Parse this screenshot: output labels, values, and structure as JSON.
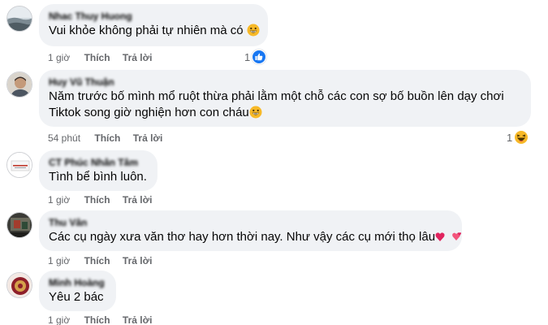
{
  "comments": [
    {
      "author": "Nhac Thuy Huong",
      "text_lines": [
        "Vui khỏe không phải tự nhiên mà có"
      ],
      "emoji": "grinning-face",
      "time": "1 giờ",
      "like_label": "Thích",
      "reply_label": "Trả lời",
      "reaction": {
        "count": "1",
        "type": "like"
      }
    },
    {
      "author": "Huy Vũ Thuận",
      "text_lines": [
        "Năm trước bố mình mổ ruột thừa phải lằm một chỗ các con sợ bố buồn lên dạy chơi",
        "Tiktok song giờ nghiện hơn con cháu"
      ],
      "emoji": "grinning-face",
      "time": "54 phút",
      "like_label": "Thích",
      "reply_label": "Trả lời",
      "reaction": {
        "count": "1",
        "type": "haha"
      }
    },
    {
      "author": "CT Phúc Nhân Tâm",
      "text_lines": [
        "Tình bể bình luôn."
      ],
      "time": "1 giờ",
      "like_label": "Thích",
      "reply_label": "Trả lời"
    },
    {
      "author": "Thu Vân",
      "text_lines": [
        "Các cụ ngày xưa văn thơ hay hơn thời nay. Như vậy các cụ mới thọ lâu"
      ],
      "emoji": "two-hearts",
      "time": "1 giờ",
      "like_label": "Thích",
      "reply_label": "Trả lời"
    },
    {
      "author": "Minh Hoàng",
      "text_lines": [
        "Yêu 2 bác"
      ],
      "time": "1 giờ",
      "like_label": "Thích",
      "reply_label": "Trả lời"
    }
  ],
  "colors": {
    "bubble": "#f0f2f5",
    "meta": "#65676b",
    "like_blue": "#1877f2",
    "emoji_yellow": "#f7b928",
    "heart_pink": "#e0245e"
  }
}
